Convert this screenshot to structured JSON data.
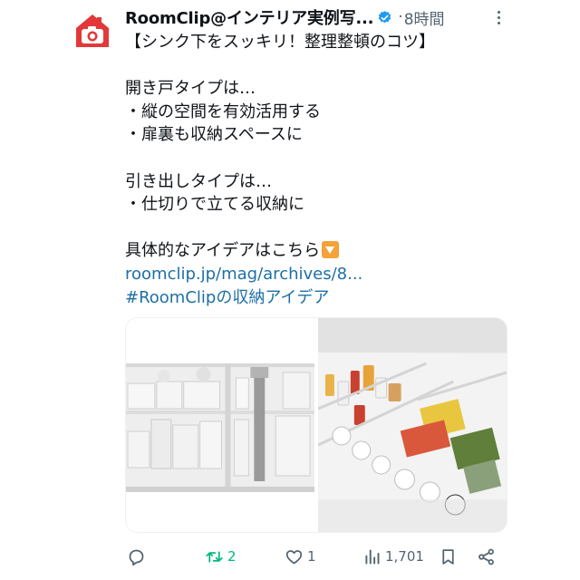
{
  "tweet": {
    "author": {
      "display_name": "RoomClip@インテリア実例写...",
      "verified": true,
      "avatar_icon": "house-camera-logo",
      "avatar_color": "#e2383a"
    },
    "separator": "·",
    "time": "8時間",
    "more_icon": "more-vertical-icon",
    "body_lines": [
      "【シンク下をスッキリ！整理整頓のコツ】",
      "",
      "開き戸タイプは…",
      "・縦の空間を有効活用する",
      "・扉裏も収納スペースに",
      "",
      "引き出しタイプは…",
      "・仕切りで立てる収納に",
      "",
      "具体的なアイデアはこちら"
    ],
    "emoji": "down-arrow-emoji",
    "link": "roomclip.jp/mag/archives/8...",
    "hashtag": "#RoomClipの収納アイデア",
    "link_color": "#1d6fa5",
    "media": [
      {
        "kind": "photo",
        "subject": "under-sink-cabinet-storage"
      },
      {
        "kind": "photo",
        "subject": "drawer-organizer-storage"
      }
    ],
    "actions": {
      "reply": {
        "icon": "reply-icon",
        "count": ""
      },
      "retweet": {
        "icon": "retweet-icon",
        "count": "2",
        "color": "#00ba7c"
      },
      "like": {
        "icon": "heart-icon",
        "count": "1"
      },
      "views": {
        "icon": "views-chart-icon",
        "count": "1,701"
      },
      "bookmark": {
        "icon": "bookmark-icon"
      },
      "share": {
        "icon": "share-icon"
      }
    }
  }
}
